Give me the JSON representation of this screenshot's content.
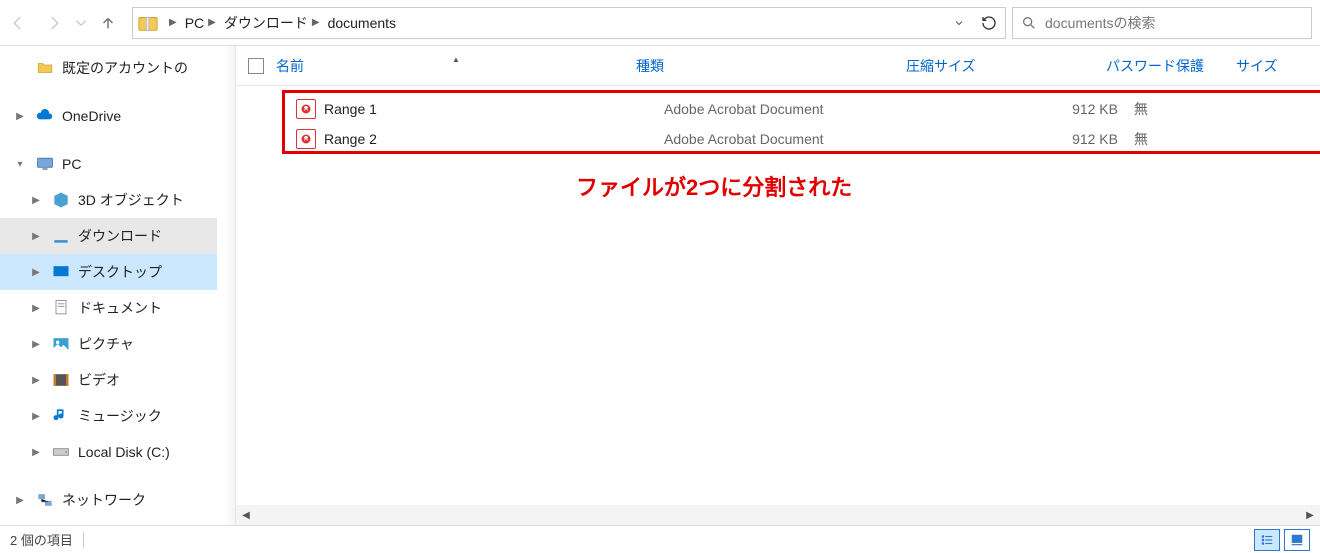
{
  "breadcrumb": [
    "PC",
    "ダウンロード",
    "documents"
  ],
  "search_placeholder": "documentsの検索",
  "sidebar": {
    "default_account": "既定のアカウントの",
    "onedrive": "OneDrive",
    "pc": "PC",
    "pc_children": [
      "3D オブジェクト",
      "ダウンロード",
      "デスクトップ",
      "ドキュメント",
      "ピクチャ",
      "ビデオ",
      "ミュージック",
      "Local Disk (C:)"
    ],
    "network": "ネットワーク"
  },
  "columns": {
    "name": "名前",
    "type": "種類",
    "csize": "圧縮サイズ",
    "pwd": "パスワード保護",
    "size": "サイズ"
  },
  "rows": [
    {
      "name": "Range 1",
      "type": "Adobe Acrobat Document",
      "csize": "912 KB",
      "pwd": "無"
    },
    {
      "name": "Range 2",
      "type": "Adobe Acrobat Document",
      "csize": "912 KB",
      "pwd": "無"
    }
  ],
  "annotation": "ファイルが2つに分割された",
  "status": {
    "items": "2 個の項目"
  }
}
